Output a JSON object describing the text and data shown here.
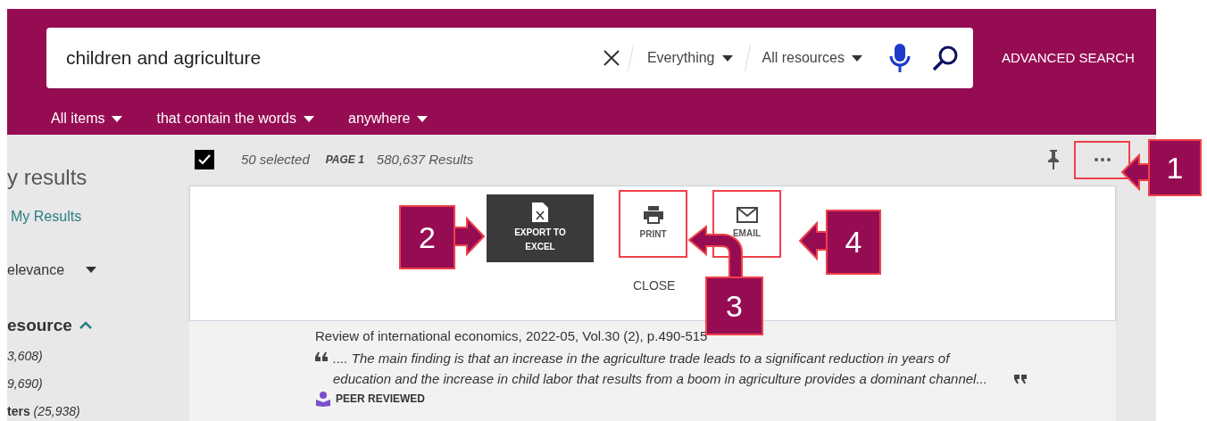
{
  "search": {
    "query": "children and agriculture",
    "scope": "Everything",
    "resources": "All resources",
    "advanced": "ADVANCED SEARCH"
  },
  "filters": [
    {
      "label": "All items"
    },
    {
      "label": "that contain the words"
    },
    {
      "label": "anywhere"
    }
  ],
  "sidebar": {
    "heading": "y results",
    "link": "My Results",
    "sort": "elevance",
    "facet": {
      "title": "esource",
      "expanded": true,
      "items": [
        {
          "count": "3,608)"
        },
        {
          "count": "9,690)"
        },
        {
          "label": "ters",
          "count": "(25,938)"
        }
      ]
    }
  },
  "toolbar": {
    "checked": true,
    "selected": "50 selected",
    "page": "PAGE 1",
    "results": "580,637 Results"
  },
  "actions": [
    {
      "kind": "excel",
      "label": "EXPORT TO EXCEL",
      "highlighted": true
    },
    {
      "kind": "print",
      "label": "PRINT",
      "highlighted": false
    },
    {
      "kind": "email",
      "label": "EMAIL",
      "highlighted": false
    }
  ],
  "close": "CLOSE",
  "result": {
    "citation": "Review of international economics, 2022-05, Vol.30 (2), p.490-515",
    "snippet": ".... The main finding is that an increase in the agriculture trade leads to a significant reduction in years of education and the increase in child labor that results from a boom in agriculture provides a dominant channel...",
    "badge": "PEER REVIEWED"
  },
  "callouts": [
    "1",
    "2",
    "3",
    "4"
  ]
}
